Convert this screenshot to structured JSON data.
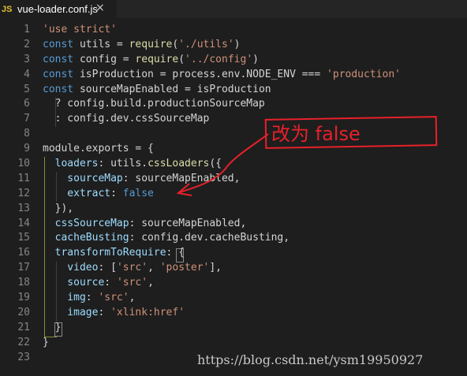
{
  "tab": {
    "icon": "JS",
    "label": "vue-loader.conf.js",
    "close": "×"
  },
  "line_numbers": [
    "1",
    "2",
    "3",
    "4",
    "5",
    "6",
    "7",
    "8",
    "9",
    "10",
    "11",
    "12",
    "13",
    "14",
    "15",
    "16",
    "17",
    "18",
    "19",
    "20",
    "21",
    "22",
    "23"
  ],
  "code": {
    "l1": {
      "s": "'use strict'"
    },
    "l2": {
      "kw": "const",
      "a": " utils = ",
      "fn": "require",
      "b": "(",
      "s": "'./utils'",
      "c": ")"
    },
    "l3": {
      "kw": "const",
      "a": " config = ",
      "fn": "require",
      "b": "(",
      "s": "'../config'",
      "c": ")"
    },
    "l4": {
      "kw": "const",
      "a": " isProduction = process.env.NODE_ENV === ",
      "s": "'production'"
    },
    "l5": {
      "kw": "const",
      "a": " sourceMapEnabled = isProduction"
    },
    "l6": {
      "a": "  ? config.build.productionSourceMap"
    },
    "l7": {
      "a": "  : config.dev.cssSourceMap"
    },
    "l8": {
      "a": ""
    },
    "l9": {
      "a": "module.exports = {"
    },
    "l10": {
      "p": "  loaders",
      "a": ": utils.",
      "fn": "cssLoaders",
      "b": "({"
    },
    "l11": {
      "p": "    sourceMap",
      "a": ": sourceMapEnabled,"
    },
    "l12": {
      "p": "    extract",
      "a": ": ",
      "k": "false"
    },
    "l13": {
      "a": "  }),"
    },
    "l14": {
      "p": "  cssSourceMap",
      "a": ": sourceMapEnabled,"
    },
    "l15": {
      "p": "  cacheBusting",
      "a": ": config.dev.cacheBusting,"
    },
    "l16": {
      "p": "  transformToRequire",
      "a": ": {"
    },
    "l17": {
      "p": "    video",
      "a": ": [",
      "s1": "'src'",
      "b": ", ",
      "s2": "'poster'",
      "c": "],"
    },
    "l18": {
      "p": "    source",
      "a": ": ",
      "s": "'src'",
      "c": ","
    },
    "l19": {
      "p": "    img",
      "a": ": ",
      "s": "'src'",
      "c": ","
    },
    "l20": {
      "p": "    image",
      "a": ": ",
      "s": "'xlink:href'"
    },
    "l21": {
      "a": "  }"
    },
    "l22": {
      "a": "}"
    },
    "l23": {
      "a": ""
    }
  },
  "annotation": {
    "text": "改为 false",
    "color": "#e8202a"
  },
  "watermark": "https://blog.csdn.net/ysm19950927",
  "colors": {
    "keyword": "#569cd6",
    "string": "#ce9178",
    "property": "#9cdcfe",
    "function": "#dcdcaa",
    "line_number": "#858585",
    "background": "#1e1e1e"
  }
}
